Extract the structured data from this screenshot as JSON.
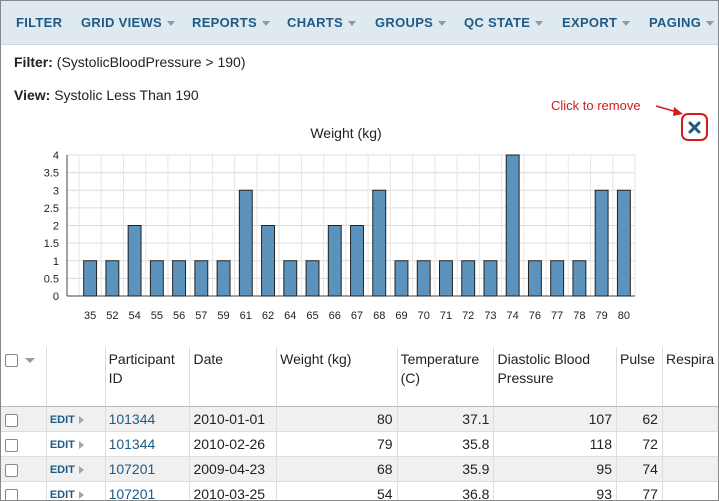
{
  "toolbar": {
    "items": [
      "FILTER",
      "GRID VIEWS",
      "REPORTS",
      "CHARTS",
      "GROUPS",
      "QC STATE",
      "EXPORT",
      "PAGING"
    ]
  },
  "filter": {
    "label": "Filter:",
    "value": "(SystolicBloodPressure > 190)"
  },
  "view": {
    "label": "View:",
    "value": "Systolic Less Than 190"
  },
  "annotation": {
    "text": "Click to remove",
    "color": "#d41b1b"
  },
  "colors": {
    "bar": "#5b93bd",
    "bar_stroke": "#222222",
    "link": "#1f5a86",
    "accent_red": "#d41b1b"
  },
  "chart_data": {
    "type": "bar",
    "title": "Weight (kg)",
    "categories": [
      "35",
      "52",
      "54",
      "55",
      "56",
      "57",
      "59",
      "61",
      "62",
      "64",
      "65",
      "66",
      "67",
      "68",
      "69",
      "70",
      "71",
      "72",
      "73",
      "74",
      "76",
      "77",
      "78",
      "79",
      "80"
    ],
    "values": [
      1,
      1,
      2,
      1,
      1,
      1,
      1,
      3,
      2,
      1,
      1,
      2,
      2,
      3,
      1,
      1,
      1,
      1,
      1,
      4,
      1,
      1,
      1,
      3,
      3
    ],
    "y_ticks": [
      "0",
      "0.5",
      "1",
      "1.5",
      "2",
      "2.5",
      "3",
      "3.5",
      "4"
    ],
    "ylim": [
      0,
      4
    ],
    "grid": true
  },
  "table": {
    "headers": [
      "Participant ID",
      "Date",
      "Weight (kg)",
      "Temperature (C)",
      "Diastolic Blood Pressure",
      "Pulse",
      "Respira"
    ],
    "edit_label": "EDIT",
    "rows": [
      [
        "101344",
        "2010-01-01",
        "80",
        "37.1",
        "107",
        "62"
      ],
      [
        "101344",
        "2010-02-26",
        "79",
        "35.8",
        "118",
        "72"
      ],
      [
        "107201",
        "2009-04-23",
        "68",
        "35.9",
        "95",
        "74"
      ],
      [
        "107201",
        "2010-03-25",
        "54",
        "36.8",
        "93",
        "77"
      ]
    ]
  }
}
